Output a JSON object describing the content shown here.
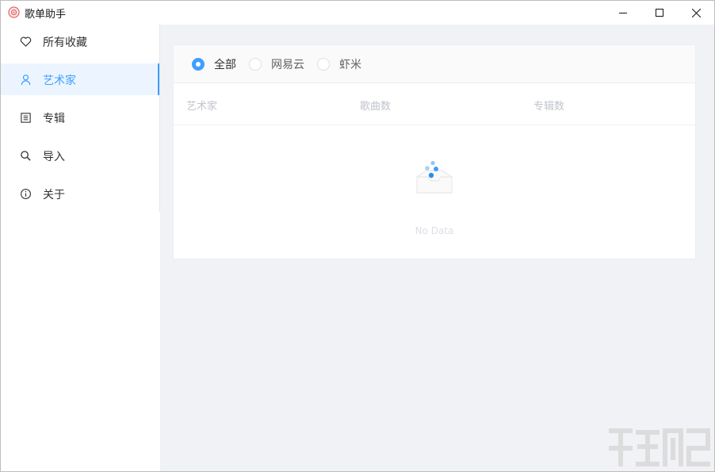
{
  "window": {
    "title": "歌单助手"
  },
  "sidebar": {
    "items": [
      {
        "label": "所有收藏",
        "icon": "heart-icon"
      },
      {
        "label": "艺术家",
        "icon": "user-icon",
        "active": true
      },
      {
        "label": "专辑",
        "icon": "album-icon"
      },
      {
        "label": "导入",
        "icon": "search-icon"
      },
      {
        "label": "关于",
        "icon": "info-icon"
      }
    ]
  },
  "filter": {
    "options": [
      {
        "label": "全部",
        "checked": true
      },
      {
        "label": "网易云",
        "checked": false
      },
      {
        "label": "虾米",
        "checked": false
      }
    ]
  },
  "table": {
    "columns": [
      "艺术家",
      "歌曲数",
      "专辑数"
    ],
    "empty_text": "No Data"
  },
  "colors": {
    "accent": "#409eff",
    "main_bg": "#f0f2f5"
  }
}
